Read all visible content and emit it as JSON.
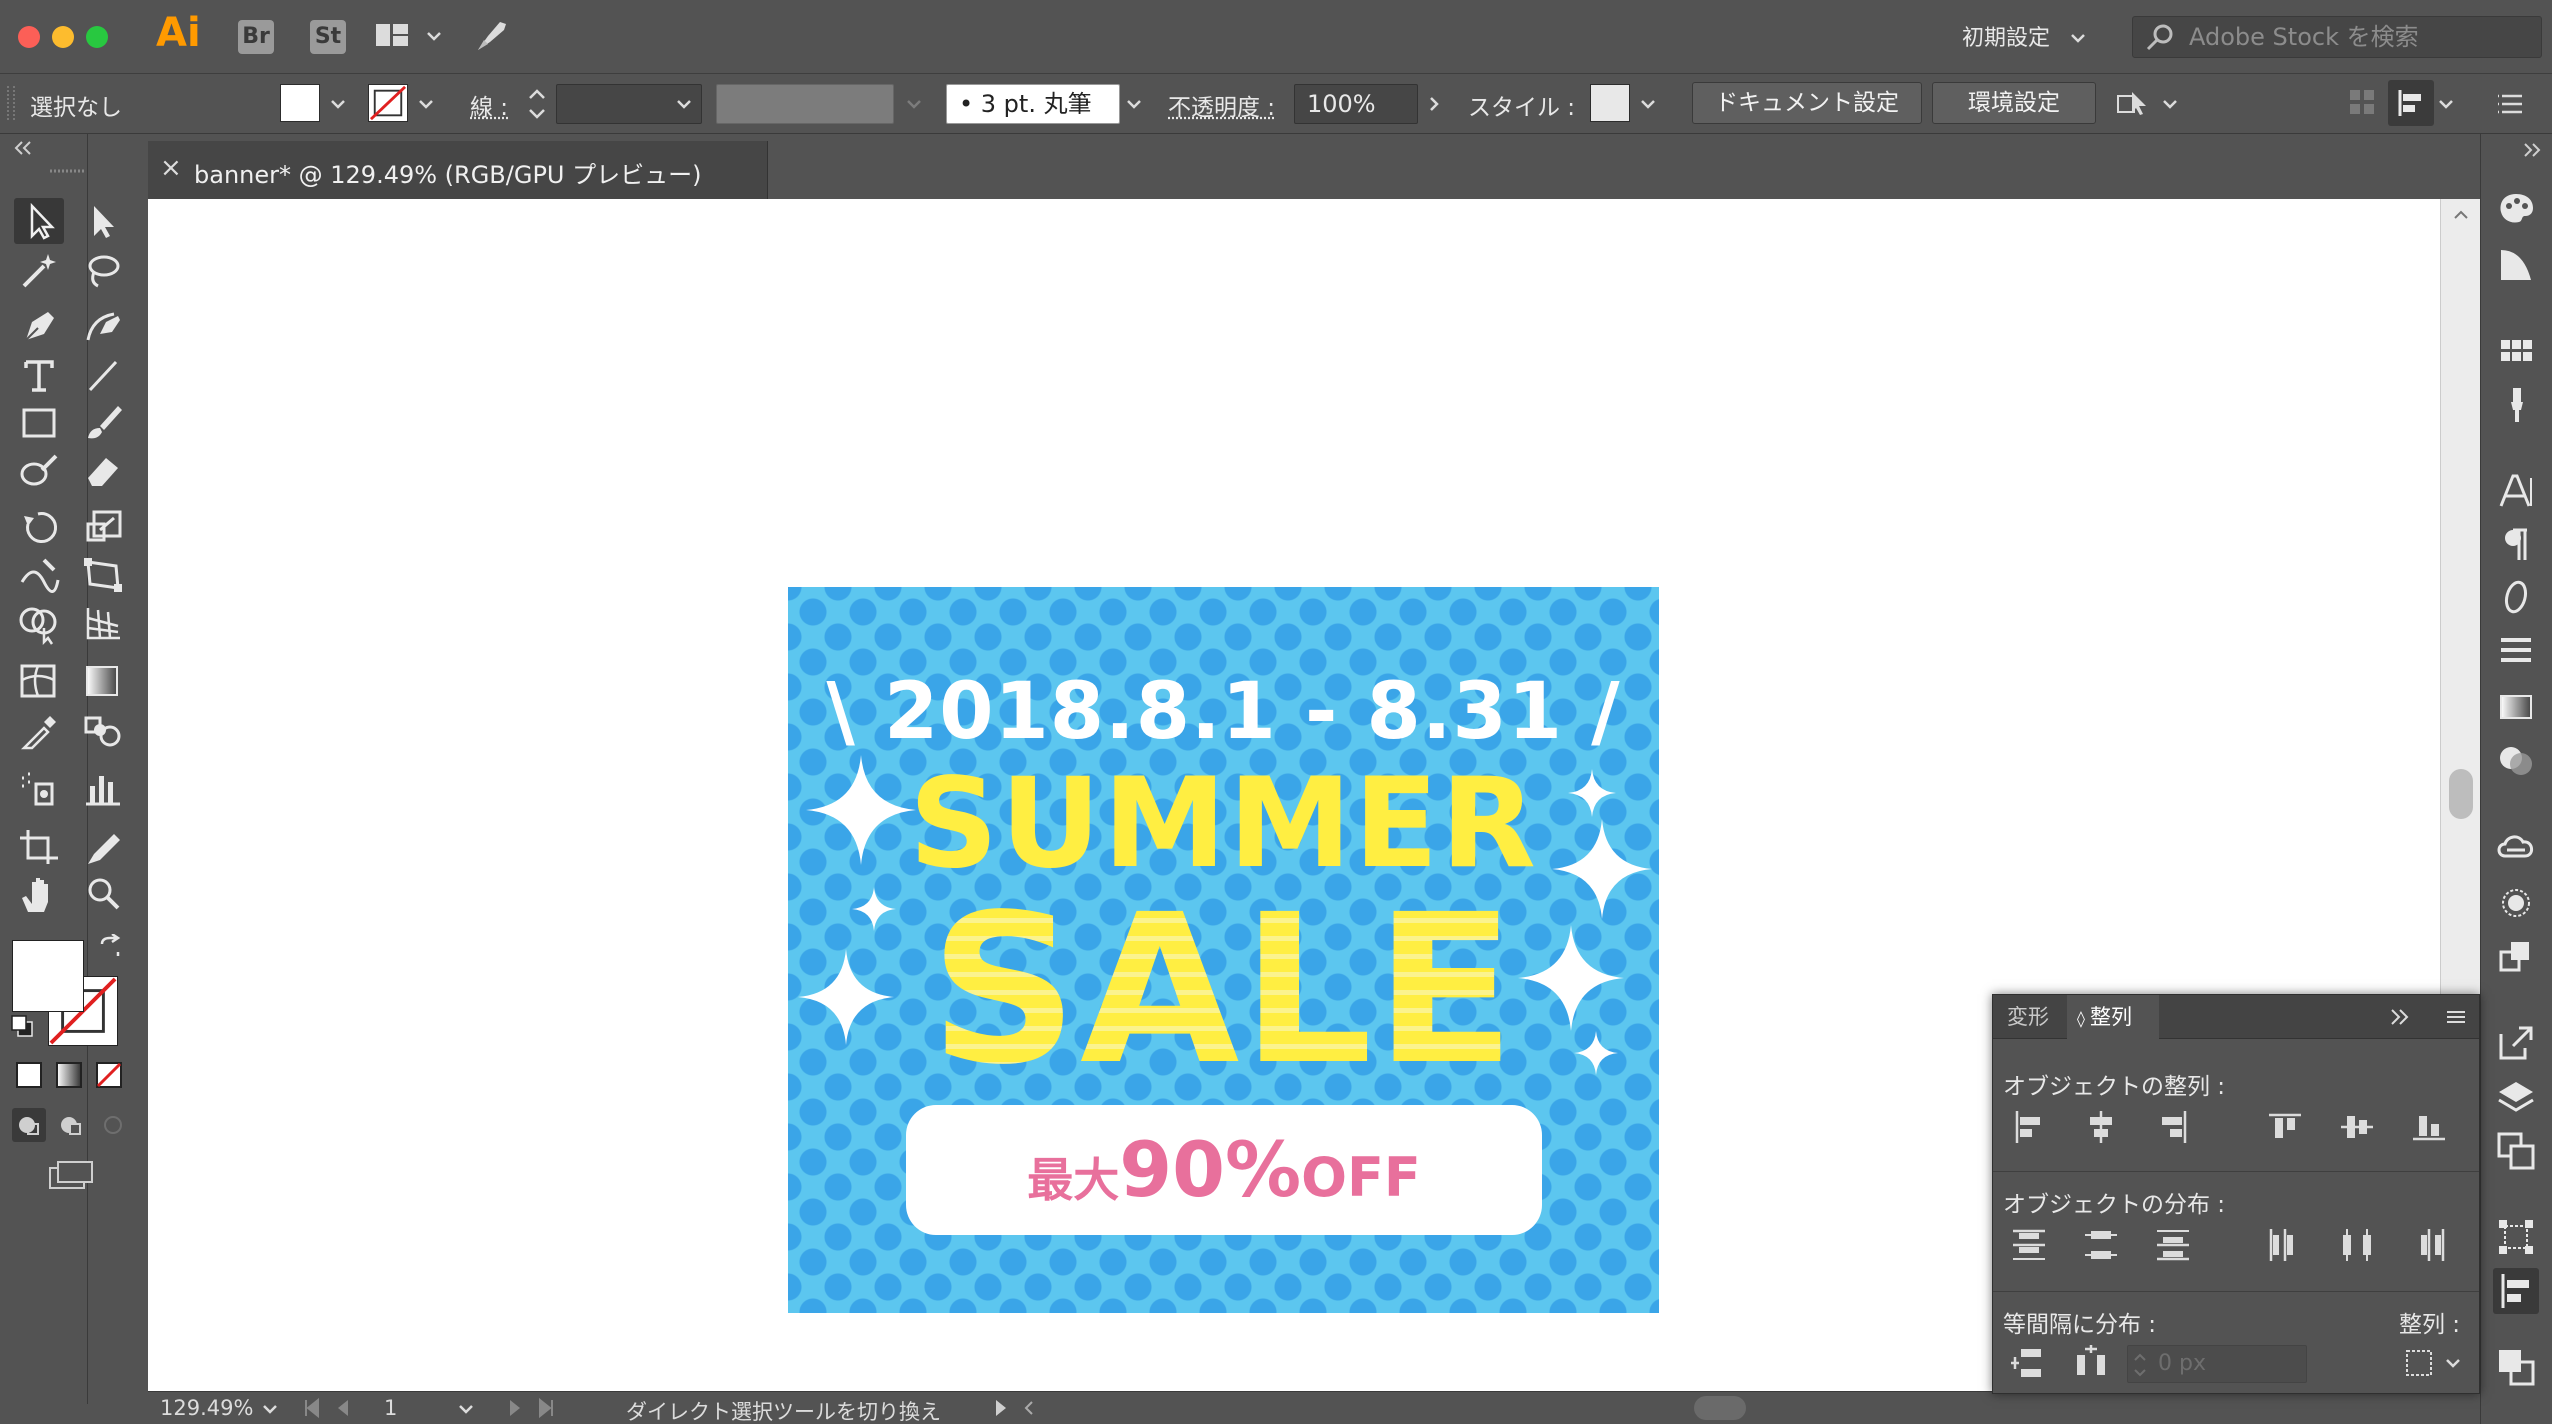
{
  "app": {
    "logo": "Ai",
    "bridge_btn": "Br",
    "stock_btn": "St",
    "workspace": "初期設定",
    "stock_search_placeholder": "Adobe Stock を検索"
  },
  "control_bar": {
    "selection": "選択なし",
    "stroke_label": "線 :",
    "brush": "• 3 pt. 丸筆",
    "opacity_label": "不透明度 :",
    "opacity_value": "100%",
    "style_label": "スタイル :",
    "doc_settings": "ドキュメント設定",
    "preferences": "環境設定"
  },
  "document_tab": {
    "close": "×",
    "title": "banner* @ 129.49% (RGB/GPU プレビュー)"
  },
  "artwork": {
    "date": "\\ 2018.8.1 - 8.31 /",
    "line1": "SUMMER",
    "line2": "SALE",
    "pill_prefix": "最大",
    "pill_number": "90%",
    "pill_suffix": "OFF",
    "colors": {
      "background": "#5cc6ef",
      "dots": "#3aa5e8",
      "yellow": "#ffee42",
      "pink": "#e8709c"
    }
  },
  "status_bar": {
    "zoom": "129.49%",
    "artboard": "1",
    "tool_hint": "ダイレクト選択ツールを切り換え"
  },
  "align_panel": {
    "tab_transform": "変形",
    "tab_align": "整列",
    "align_objects": "オブジェクトの整列 :",
    "distribute_objects": "オブジェクトの分布 :",
    "distribute_spacing": "等間隔に分布 :",
    "align_to": "整列 :",
    "spacing_placeholder": "0 px"
  }
}
